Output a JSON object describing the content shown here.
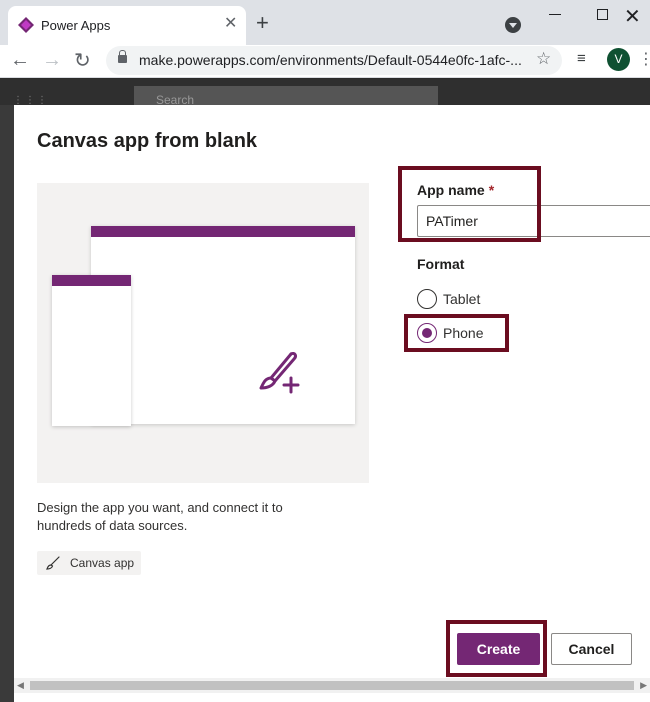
{
  "browser": {
    "tab_title": "Power Apps",
    "tab_close": "✕",
    "new_tab": "+",
    "url": "make.powerapps.com/environments/Default-0544e0fc-1afc-...",
    "profile_initial": "V"
  },
  "background": {
    "search_placeholder": "Search"
  },
  "dialog": {
    "title": "Canvas app from blank",
    "description": "Design the app you want, and connect it to hundreds of data sources.",
    "tag_label": "Canvas app",
    "app_name_label": "App name",
    "required_mark": "*",
    "app_name_value": "PATimer",
    "format_label": "Format",
    "format_options": [
      {
        "label": "Tablet",
        "checked": false
      },
      {
        "label": "Phone",
        "checked": true
      }
    ],
    "create_label": "Create",
    "cancel_label": "Cancel"
  },
  "colors": {
    "brand": "#742774",
    "highlight": "#6b0d20"
  },
  "icons": {
    "favicon": "power-apps-icon",
    "preview": "brush-plus-icon",
    "tag": "brush-icon"
  }
}
